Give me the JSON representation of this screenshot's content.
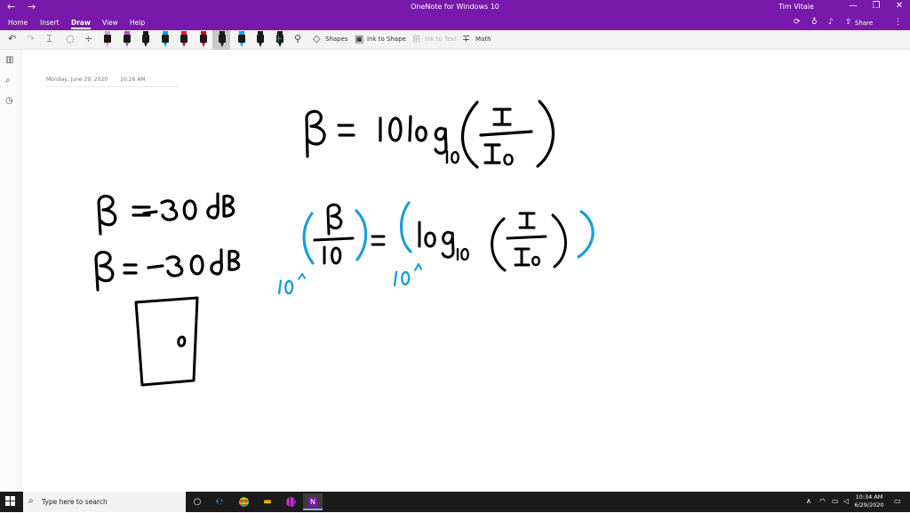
{
  "window": {
    "title": "OneNote for Windows 10",
    "user": "Tim Vitale",
    "back_glyph": "←",
    "forward_glyph": "→",
    "minimize_glyph": "—",
    "restore_glyph": "❐",
    "close_glyph": "✕"
  },
  "ribbon": {
    "tabs": [
      "Home",
      "Insert",
      "Draw",
      "View",
      "Help"
    ],
    "active_tab": "Draw",
    "share_label": "Share",
    "more_glyph": "⋮"
  },
  "draw_toolbar": {
    "undo_glyph": "↶",
    "redo_glyph": "↷",
    "type_glyph": "⌶",
    "lasso_glyph": "◌",
    "space_glyph": "÷",
    "add_pen_glyph": "+",
    "shapes_label": "Shapes",
    "ink_to_shape_label": "Ink to Shape",
    "ink_to_text_label": "Ink to Text",
    "math_label": "Math",
    "pen_colors": [
      "#c9a3e8",
      "#b14fc5",
      "#1a1a1a",
      "#00a4ef",
      "#e81123",
      "#c50f1f",
      "#1a1a1a",
      "#00a4ef",
      "#1a1a1a",
      "#1a1a1a"
    ]
  },
  "left_rail": {
    "notebooks_glyph": "▥",
    "search_glyph": "⌕",
    "recent_glyph": "◷"
  },
  "page": {
    "date": "Monday, June 29, 2020",
    "time": "10:26 AM"
  },
  "ink_notes": {
    "formula": "β = 10 log₁₀(I / I₀)",
    "line1": "β = -30 dB",
    "line2": "β = -30 dB",
    "step": "(β / 10) = (log₁₀ (I / I₀))",
    "exponent_base_left": "10^",
    "exponent_base_right": "10^",
    "ink_black": "#000000",
    "ink_blue": "#1a9fd6"
  },
  "taskbar": {
    "search_placeholder": "Type here to search",
    "search_glyph": "⌕",
    "time": "10:34 AM",
    "date": "6/29/2020",
    "tray_up_glyph": "∧",
    "tray_wifi_glyph": "◠",
    "tray_volume_glyph": "◁",
    "tray_notify_glyph": "▭",
    "task_view_glyph": "○",
    "edge_glyph": "℮"
  },
  "colors": {
    "brand": "#7719aa",
    "taskbar": "#1b1b1b"
  }
}
